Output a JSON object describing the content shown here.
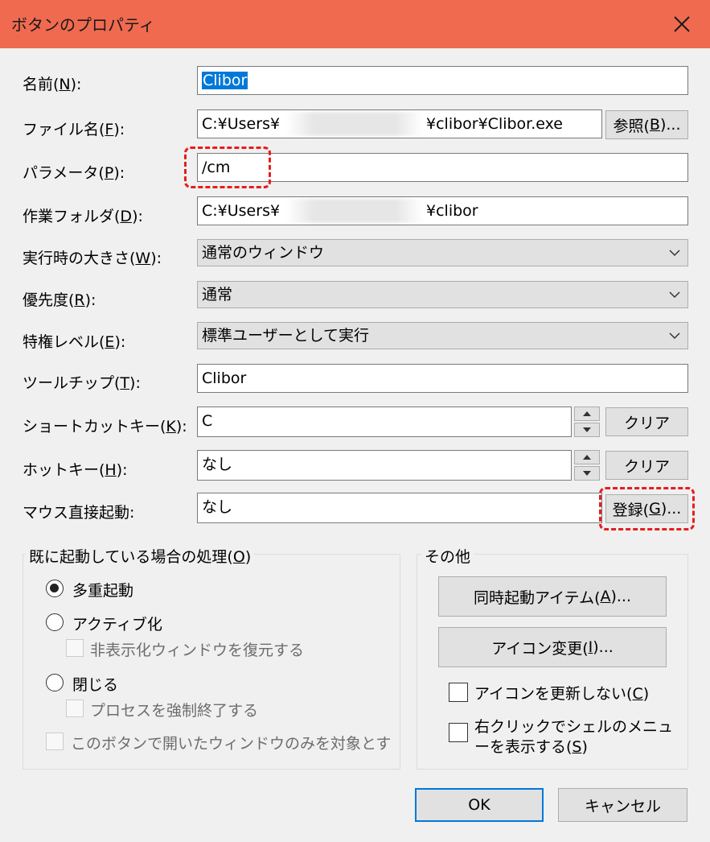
{
  "window": {
    "title": "ボタンのプロパティ"
  },
  "fields": {
    "name": {
      "label": "名前(",
      "key": "N",
      "suffix": "):",
      "value": "Clibor"
    },
    "filename": {
      "label": "ファイル名(",
      "key": "F",
      "suffix": "):",
      "value_prefix": "C:¥Users¥",
      "value_suffix": "¥clibor¥Clibor.exe",
      "browse": {
        "label": "参照(",
        "key": "B",
        "suffix": ")..."
      }
    },
    "parameter": {
      "label": "パラメータ(",
      "key": "P",
      "suffix": "):",
      "value": "/cm"
    },
    "workdir": {
      "label": "作業フォルダ(",
      "key": "D",
      "suffix": "):",
      "value_prefix": "C:¥Users¥",
      "value_suffix": "¥clibor"
    },
    "runsize": {
      "label": "実行時の大きさ(",
      "key": "W",
      "suffix": "):",
      "value": "通常のウィンドウ"
    },
    "priority": {
      "label": "優先度(",
      "key": "R",
      "suffix": "):",
      "value": "通常"
    },
    "privilege": {
      "label": "特権レベル(",
      "key": "E",
      "suffix": "):",
      "value": "標準ユーザーとして実行"
    },
    "tooltip": {
      "label": "ツールチップ(",
      "key": "T",
      "suffix": "):",
      "value": "Clibor"
    },
    "shortcut": {
      "label": "ショートカットキー(",
      "key": "K",
      "suffix": "):",
      "value": "C",
      "clear": "クリア"
    },
    "hotkey": {
      "label": "ホットキー(",
      "key": "H",
      "suffix": "):",
      "value": "なし",
      "clear": "クリア"
    },
    "mouse": {
      "label": "マウス直接起動:",
      "value": "なし",
      "register": {
        "label": "登録(",
        "key": "G",
        "suffix": ")..."
      }
    }
  },
  "already_running": {
    "title": "既に起動している場合の処理(",
    "title_key": "O",
    "title_suffix": ")",
    "options": [
      {
        "label": "多重起動",
        "selected": true
      },
      {
        "label": "アクティブ化",
        "selected": false
      },
      {
        "label": "閉じる",
        "selected": false
      }
    ],
    "sub_restore": "非表示化ウィンドウを復元する",
    "sub_kill": "プロセスを強制終了する",
    "only_window": "このボタンで開いたウィンドウのみを対象とす"
  },
  "other": {
    "title": "その他",
    "simul": {
      "label": "同時起動アイテム(",
      "key": "A",
      "suffix": ")..."
    },
    "icon_change": {
      "label": "アイコン変更(",
      "key": "I",
      "suffix": ")..."
    },
    "no_update_icon": {
      "label": "アイコンを更新しない(",
      "key": "C",
      "suffix": ")"
    },
    "shell_menu": {
      "line1": "右クリックでシェルのメニュ",
      "line2": "ーを表示する(",
      "key": "S",
      "suffix": ")"
    }
  },
  "footer": {
    "ok": "OK",
    "cancel": "キャンセル"
  },
  "colors": {
    "titlebar": "#f06a50",
    "highlight": "#e41e1e",
    "selection": "#0078d7"
  }
}
